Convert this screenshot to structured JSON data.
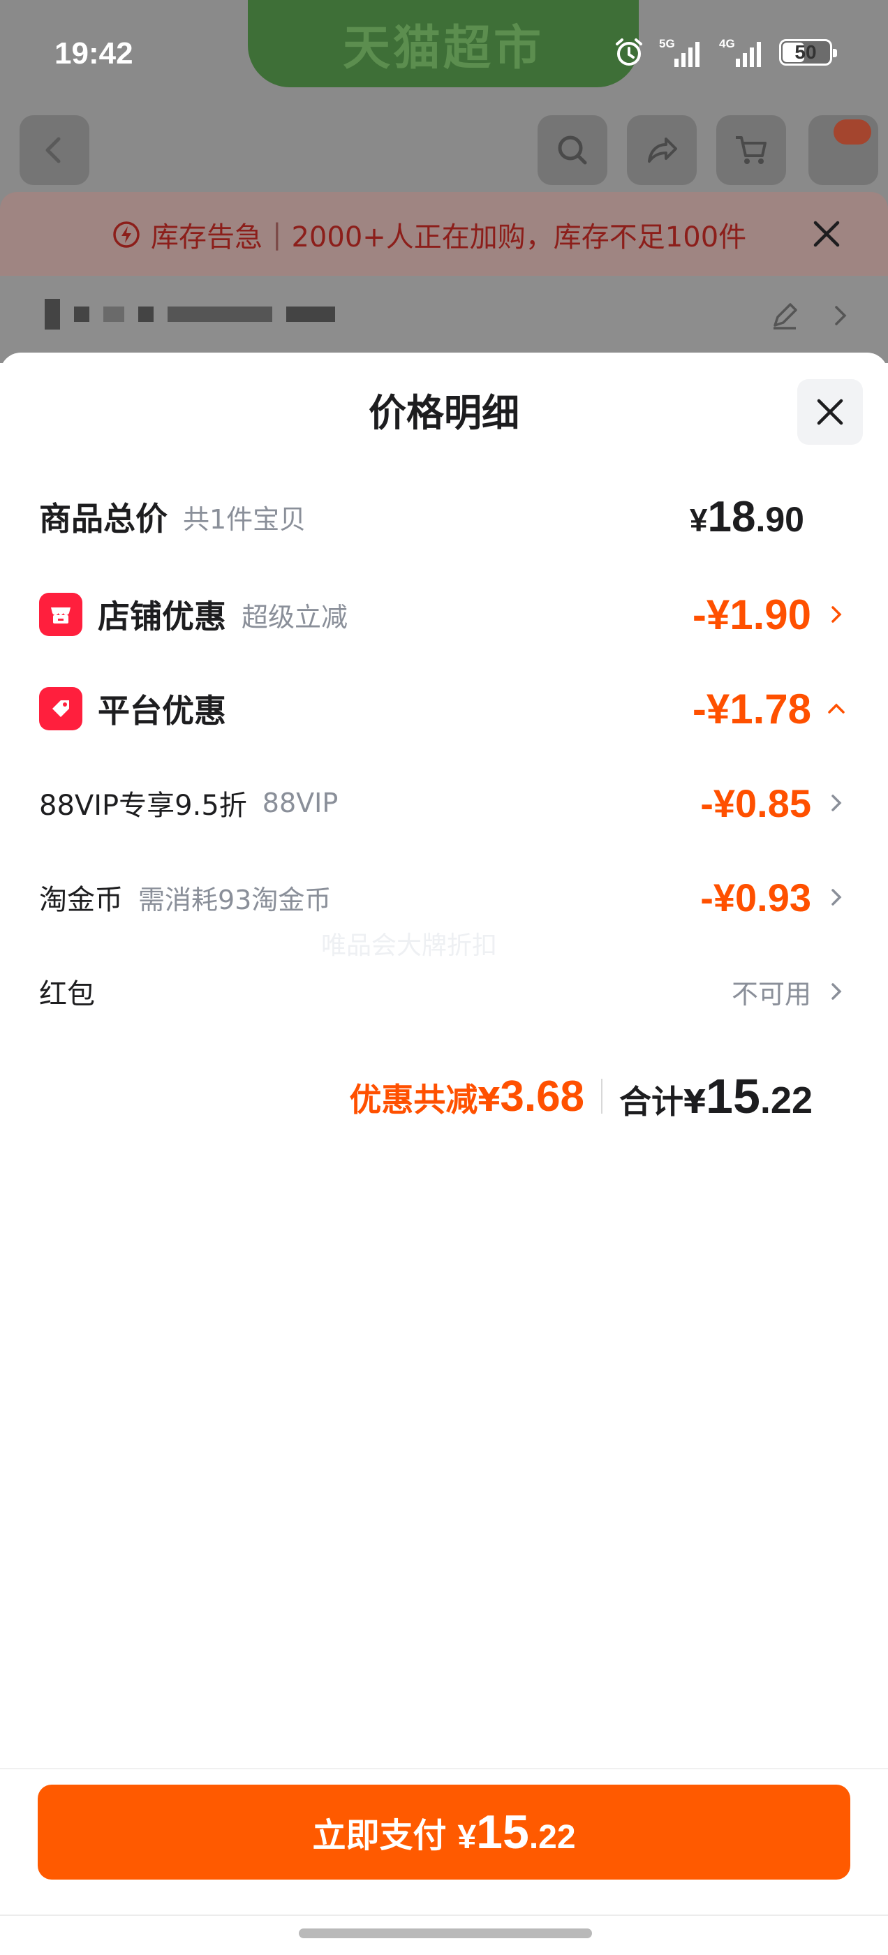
{
  "status_bar": {
    "time": "19:42",
    "network_1": "5G",
    "network_2": "4G",
    "battery": "50"
  },
  "background": {
    "store_title": "天猫超市",
    "stock_alert": {
      "label": "库存告急",
      "message": "2000+人正在加购，库存不足100件"
    }
  },
  "sheet": {
    "title": "价格明细",
    "goods_total": {
      "label": "商品总价",
      "note": "共1件宝贝",
      "currency": "¥",
      "integer": "18",
      "cents": ".90"
    },
    "store_discount": {
      "label": "店铺优惠",
      "note": "超级立减",
      "amount": "-¥1.90"
    },
    "platform_discount": {
      "label": "平台优惠",
      "amount": "-¥1.78"
    },
    "vip_discount": {
      "label": "88VIP专享9.5折",
      "note": "88VIP",
      "amount": "-¥0.85"
    },
    "coin_discount": {
      "label": "淘金币",
      "note": "需消耗93淘金币",
      "amount": "-¥0.93"
    },
    "red_packet": {
      "label": "红包",
      "status": "不可用"
    },
    "watermark": "唯品会大牌折扣",
    "summary": {
      "discount_label": "优惠共减¥",
      "discount_value": "3.68",
      "total_label": "合计¥",
      "total_integer": "15",
      "total_cents": ".22"
    }
  },
  "pay_button": {
    "label": "立即支付",
    "currency": "¥",
    "integer": "15",
    "cents": ".22"
  },
  "colors": {
    "accent": "#ff5000",
    "button": "#ff5a00",
    "badge_red": "#ff1f3d",
    "text_dark": "#1d1d1f",
    "text_muted": "#8a8f99"
  },
  "icons": [
    "back-icon",
    "search-icon",
    "share-icon",
    "cart-icon",
    "more-icon",
    "close-icon",
    "store-icon",
    "coupon-tag-icon",
    "chevron-right-icon",
    "chevron-up-icon",
    "edit-icon",
    "alarm-icon",
    "lightning-icon"
  ]
}
